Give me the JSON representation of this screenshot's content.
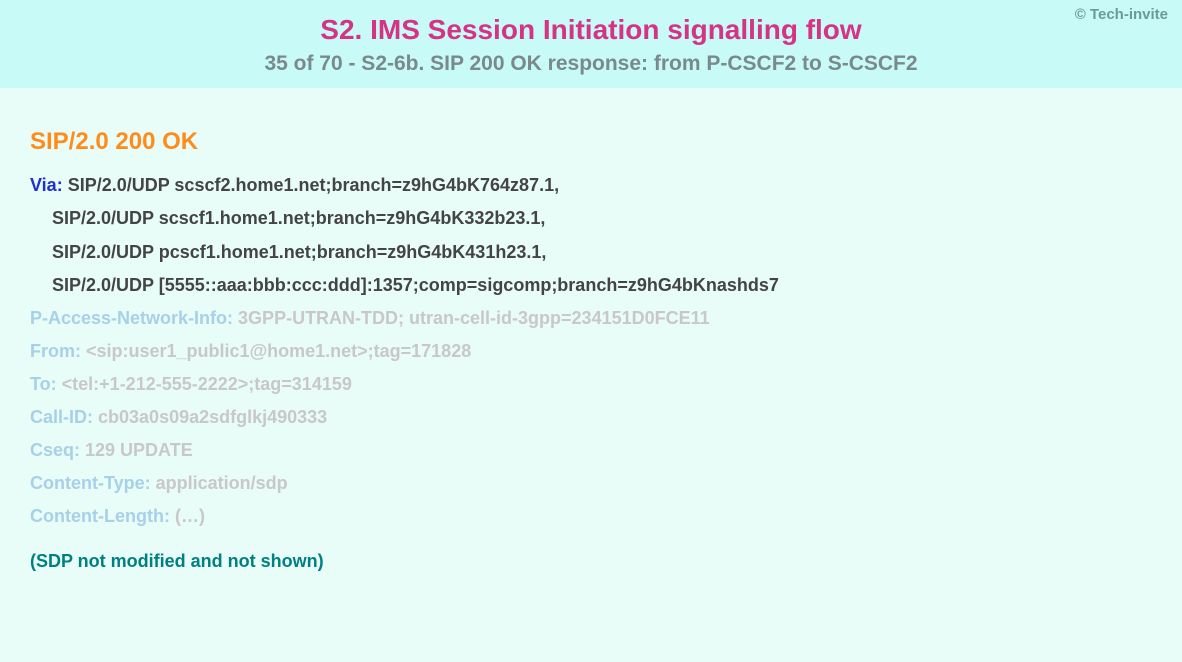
{
  "header": {
    "copyright": "© Tech-invite",
    "title": "S2. IMS Session Initiation signalling flow",
    "subtitle": "35 of 70 - S2-6b. SIP 200 OK response: from P-CSCF2 to S-CSCF2"
  },
  "sip": {
    "status_line": "SIP/2.0 200 OK",
    "via": {
      "name": "Via",
      "sep": ": ",
      "first": "SIP/2.0/UDP scscf2.home1.net;branch=z9hG4bK764z87.1,",
      "cont1": "SIP/2.0/UDP scscf1.home1.net;branch=z9hG4bK332b23.1,",
      "cont2": "SIP/2.0/UDP pcscf1.home1.net;branch=z9hG4bK431h23.1,",
      "cont3": "SIP/2.0/UDP [5555::aaa:bbb:ccc:ddd]:1357;comp=sigcomp;branch=z9hG4bKnashds7"
    },
    "pani": {
      "name": "P-Access-Network-Info",
      "sep": ": ",
      "val": "3GPP-UTRAN-TDD; utran-cell-id-3gpp=234151D0FCE11"
    },
    "from": {
      "name": "From",
      "sep": ": ",
      "val": "<sip:user1_public1@home1.net>;tag=171828"
    },
    "to": {
      "name": "To",
      "sep": ": ",
      "val": "<tel:+1-212-555-2222>;tag=314159"
    },
    "callid": {
      "name": "Call-ID",
      "sep": ": ",
      "val": "cb03a0s09a2sdfglkj490333"
    },
    "cseq": {
      "name": "Cseq",
      "sep": ": ",
      "val": "129 UPDATE"
    },
    "ctype": {
      "name": "Content-Type",
      "sep": ": ",
      "val": "application/sdp"
    },
    "clen": {
      "name": "Content-Length",
      "sep": ": ",
      "val": "(…)"
    },
    "sdp_note": "(SDP not modified and not shown)"
  }
}
